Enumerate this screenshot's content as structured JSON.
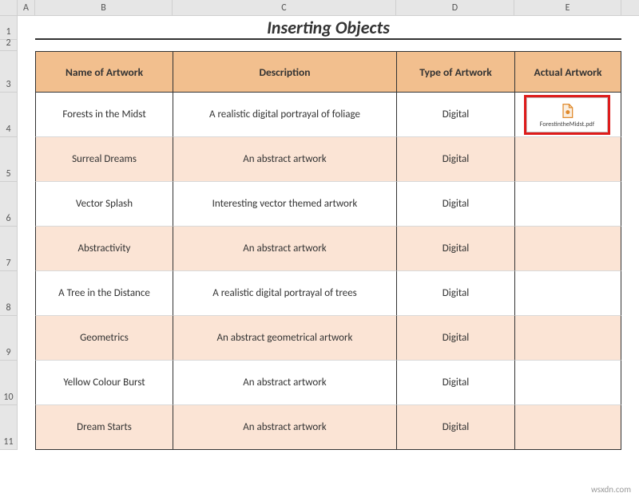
{
  "sheet": {
    "columns": [
      "A",
      "B",
      "C",
      "D",
      "E"
    ],
    "rows": [
      "1",
      "2",
      "3",
      "4",
      "5",
      "6",
      "7",
      "8",
      "9",
      "10",
      "11"
    ]
  },
  "title": "Inserting Objects",
  "headers": {
    "name": "Name of Artwork",
    "desc": "Description",
    "type": "Type of Artwork",
    "actual": "Actual Artwork"
  },
  "rows": [
    {
      "name": "Forests in the Midst",
      "desc": "A realistic digital portrayal of  foliage",
      "type": "Digital"
    },
    {
      "name": "Surreal Dreams",
      "desc": "An abstract artwork",
      "type": "Digital"
    },
    {
      "name": "Vector Splash",
      "desc": "Interesting vector themed artwork",
      "type": "Digital"
    },
    {
      "name": "Abstractivity",
      "desc": "An abstract artwork",
      "type": "Digital"
    },
    {
      "name": "A Tree in the Distance",
      "desc": "A realistic digital portrayal of trees",
      "type": "Digital"
    },
    {
      "name": "Geometrics",
      "desc": "An abstract geometrical artwork",
      "type": "Digital"
    },
    {
      "name": "Yellow Colour Burst",
      "desc": "An abstract artwork",
      "type": "Digital"
    },
    {
      "name": "Dream Starts",
      "desc": "An abstract artwork",
      "type": "Digital"
    }
  ],
  "embedded": {
    "filename": "ForestintheMidst.pdf",
    "icon": "pdf-icon"
  },
  "watermark": "wsxdn.com",
  "colors": {
    "header_bg": "#f2bf8e",
    "alt_bg": "#fbe4d5",
    "highlight": "#de1b1b"
  }
}
